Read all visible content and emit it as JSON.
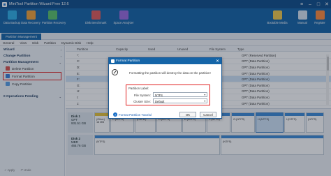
{
  "window": {
    "title": "MiniTool Partition Wizard Free 12.6"
  },
  "ribbon": {
    "tools": [
      {
        "label": "Data Backup",
        "color": "#2fb0e8"
      },
      {
        "label": "Data Recovery",
        "color": "#f0a23a"
      },
      {
        "label": "Partition Recovery",
        "color": "#5bc26b"
      },
      {
        "label": "Disk Benchmark",
        "color": "#e05b5b"
      },
      {
        "label": "Space Analyzer",
        "color": "#9a6ae0"
      },
      {
        "label": "Bootable Media",
        "color": "#f2c94c"
      },
      {
        "label": "Manual",
        "color": "#d6e4f2"
      },
      {
        "label": "Register",
        "color": "#ff8a3d"
      }
    ]
  },
  "tab": {
    "label": "Partition Management"
  },
  "menu": [
    "General",
    "View",
    "Disk",
    "Partition",
    "Dynamic Disk",
    "Help"
  ],
  "sidebar": {
    "wizard": "Wizard",
    "change_partition": "Change Partition",
    "partition_management": "Partition Management",
    "items": [
      {
        "label": "Delete Partition",
        "color": "#d9534f"
      },
      {
        "label": "Format Partition",
        "color": "#3b7dd8"
      },
      {
        "label": "Copy Partition",
        "color": "#5aa0e6"
      }
    ],
    "pending": "0 Operations Pending",
    "apply": "Apply",
    "undo": "Undo"
  },
  "table": {
    "headers": [
      "Partition",
      "Capacity",
      "Used",
      "Unused",
      "File System",
      "Type"
    ],
    "rows": [
      {
        "partition": "*:",
        "capacity": "",
        "used": "",
        "unused": "",
        "fs": "",
        "type": "GPT (Reserved Partition)"
      },
      {
        "partition": "C:",
        "capacity": "",
        "used": "",
        "unused": "",
        "fs": "",
        "type": "GPT (Data Partition)"
      },
      {
        "partition": "D:",
        "capacity": "",
        "used": "",
        "unused": "",
        "fs": "",
        "type": "GPT (Data Partition)"
      },
      {
        "partition": "E:",
        "capacity": "",
        "used": "",
        "unused": "",
        "fs": "",
        "type": "GPT (Data Partition)"
      },
      {
        "partition": "F:",
        "capacity": "",
        "used": "",
        "unused": "",
        "fs": "",
        "type": "GPT (Data Partition)"
      },
      {
        "partition": "G:",
        "capacity": "",
        "used": "",
        "unused": "",
        "fs": "",
        "type": "GPT (Data Partition)"
      },
      {
        "partition": "H:",
        "capacity": "",
        "used": "",
        "unused": "",
        "fs": "",
        "type": "GPT (Data Partition)"
      },
      {
        "partition": "I:",
        "capacity": "",
        "used": "",
        "unused": "",
        "fs": "",
        "type": "GPT (Data Partition)"
      },
      {
        "partition": "J:",
        "capacity": "",
        "used": "",
        "unused": "",
        "fs": "",
        "type": "GPT (Data Partition)"
      },
      {
        "partition": "",
        "capacity": "",
        "used": "",
        "unused": "",
        "fs": "",
        "type": "Primary"
      }
    ]
  },
  "disks": [
    {
      "name": "Disk 1",
      "style": "GPT",
      "size": "931.51 GB",
      "parts": [
        {
          "label": "(Other)",
          "sub": "16 MB"
        },
        {
          "label": "C:(NTFS)",
          "sub": ""
        },
        {
          "label": "(FAT32)",
          "sub": ""
        },
        {
          "label": "D:(NTFS)",
          "sub": ""
        },
        {
          "label": "E:(NTFS)",
          "sub": ""
        },
        {
          "label": "F:(NTFS)",
          "sub": ""
        },
        {
          "label": "G:(NTFS)",
          "sub": ""
        },
        {
          "label": "H:(NTFS)",
          "sub": ""
        },
        {
          "label": "I:(NTFS)",
          "sub": ""
        },
        {
          "label": "(NTFS)",
          "sub": ""
        }
      ]
    },
    {
      "name": "Disk 2",
      "style": "MBR",
      "size": "465.76 GB",
      "parts": [
        {
          "label": "(NTFS)",
          "sub": ""
        },
        {
          "label": "(NTFS)",
          "sub": ""
        }
      ]
    }
  ],
  "dialog": {
    "title": "Format Partition",
    "message": "Formatting the partition will destroy the data on the partition!",
    "partition_label": "Partition Label:",
    "file_system_label": "File System:",
    "file_system_value": "NTFS",
    "cluster_size_label": "Cluster Size:",
    "cluster_size_value": "Default",
    "tutorial_link": "Format Partition Tutorial",
    "ok": "OK",
    "cancel": "Cancel",
    "close": "✕"
  },
  "colors": {
    "brand": "#1565a8",
    "highlight": "#e02020",
    "selection": "#cfe3f7"
  }
}
